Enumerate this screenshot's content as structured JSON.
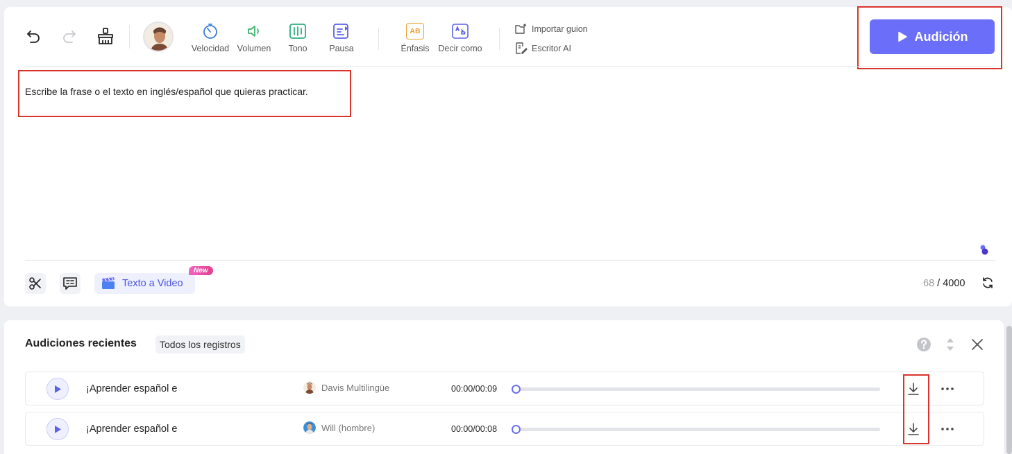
{
  "toolbar": {
    "velocidad": "Velocidad",
    "volumen": "Volumen",
    "tono": "Tono",
    "pausa": "Pausa",
    "enfasis": "Énfasis",
    "decir_como": "Decir como",
    "enfasis_icon_text": "AB",
    "importar": "Importar guion",
    "escritor": "Escritor AI"
  },
  "play_button": {
    "label": "Audición"
  },
  "editor": {
    "text": "Escribe la frase o el texto en inglés/español que quieras practicar."
  },
  "bottom_bar": {
    "texto_video": "Texto a Video",
    "new_badge": "New",
    "count_current": "68",
    "count_sep": " / ",
    "count_max": "4000"
  },
  "recent": {
    "title": "Audiciones recientes",
    "all_records": "Todos los registros",
    "rows": [
      {
        "title": "¡Aprender español e",
        "voice": "Davis Multilingüe",
        "time": "00:00/00:09",
        "progress": 0
      },
      {
        "title": "¡Aprender español e",
        "voice": "Will (hombre)",
        "time": "00:00/00:08",
        "progress": 0
      }
    ]
  },
  "colors": {
    "accent": "#6b6ef8",
    "highlight_box": "#d9342b",
    "velocidad": "#3a7bd5",
    "volumen": "#3db36b",
    "tono": "#2fae7a",
    "pausa": "#5a62e8",
    "enfasis": "#f0a030"
  }
}
